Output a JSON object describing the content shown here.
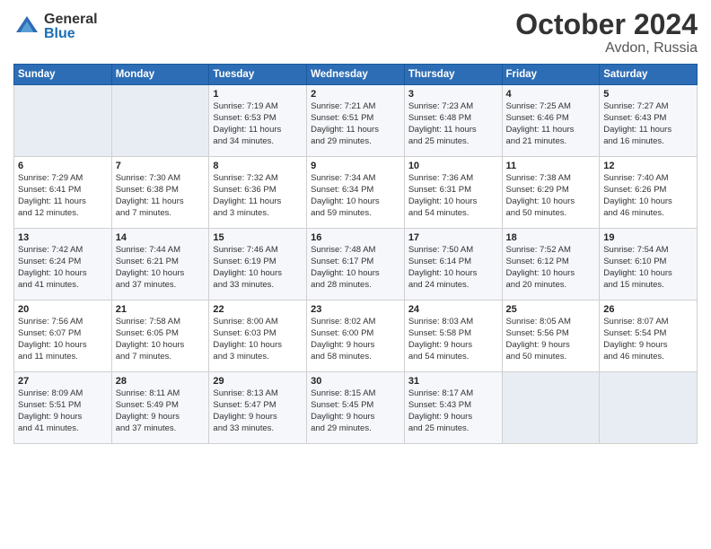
{
  "header": {
    "logo_general": "General",
    "logo_blue": "Blue",
    "month_title": "October 2024",
    "location": "Avdon, Russia"
  },
  "weekdays": [
    "Sunday",
    "Monday",
    "Tuesday",
    "Wednesday",
    "Thursday",
    "Friday",
    "Saturday"
  ],
  "weeks": [
    [
      {
        "day": "",
        "info": ""
      },
      {
        "day": "",
        "info": ""
      },
      {
        "day": "1",
        "info": "Sunrise: 7:19 AM\nSunset: 6:53 PM\nDaylight: 11 hours\nand 34 minutes."
      },
      {
        "day": "2",
        "info": "Sunrise: 7:21 AM\nSunset: 6:51 PM\nDaylight: 11 hours\nand 29 minutes."
      },
      {
        "day": "3",
        "info": "Sunrise: 7:23 AM\nSunset: 6:48 PM\nDaylight: 11 hours\nand 25 minutes."
      },
      {
        "day": "4",
        "info": "Sunrise: 7:25 AM\nSunset: 6:46 PM\nDaylight: 11 hours\nand 21 minutes."
      },
      {
        "day": "5",
        "info": "Sunrise: 7:27 AM\nSunset: 6:43 PM\nDaylight: 11 hours\nand 16 minutes."
      }
    ],
    [
      {
        "day": "6",
        "info": "Sunrise: 7:29 AM\nSunset: 6:41 PM\nDaylight: 11 hours\nand 12 minutes."
      },
      {
        "day": "7",
        "info": "Sunrise: 7:30 AM\nSunset: 6:38 PM\nDaylight: 11 hours\nand 7 minutes."
      },
      {
        "day": "8",
        "info": "Sunrise: 7:32 AM\nSunset: 6:36 PM\nDaylight: 11 hours\nand 3 minutes."
      },
      {
        "day": "9",
        "info": "Sunrise: 7:34 AM\nSunset: 6:34 PM\nDaylight: 10 hours\nand 59 minutes."
      },
      {
        "day": "10",
        "info": "Sunrise: 7:36 AM\nSunset: 6:31 PM\nDaylight: 10 hours\nand 54 minutes."
      },
      {
        "day": "11",
        "info": "Sunrise: 7:38 AM\nSunset: 6:29 PM\nDaylight: 10 hours\nand 50 minutes."
      },
      {
        "day": "12",
        "info": "Sunrise: 7:40 AM\nSunset: 6:26 PM\nDaylight: 10 hours\nand 46 minutes."
      }
    ],
    [
      {
        "day": "13",
        "info": "Sunrise: 7:42 AM\nSunset: 6:24 PM\nDaylight: 10 hours\nand 41 minutes."
      },
      {
        "day": "14",
        "info": "Sunrise: 7:44 AM\nSunset: 6:21 PM\nDaylight: 10 hours\nand 37 minutes."
      },
      {
        "day": "15",
        "info": "Sunrise: 7:46 AM\nSunset: 6:19 PM\nDaylight: 10 hours\nand 33 minutes."
      },
      {
        "day": "16",
        "info": "Sunrise: 7:48 AM\nSunset: 6:17 PM\nDaylight: 10 hours\nand 28 minutes."
      },
      {
        "day": "17",
        "info": "Sunrise: 7:50 AM\nSunset: 6:14 PM\nDaylight: 10 hours\nand 24 minutes."
      },
      {
        "day": "18",
        "info": "Sunrise: 7:52 AM\nSunset: 6:12 PM\nDaylight: 10 hours\nand 20 minutes."
      },
      {
        "day": "19",
        "info": "Sunrise: 7:54 AM\nSunset: 6:10 PM\nDaylight: 10 hours\nand 15 minutes."
      }
    ],
    [
      {
        "day": "20",
        "info": "Sunrise: 7:56 AM\nSunset: 6:07 PM\nDaylight: 10 hours\nand 11 minutes."
      },
      {
        "day": "21",
        "info": "Sunrise: 7:58 AM\nSunset: 6:05 PM\nDaylight: 10 hours\nand 7 minutes."
      },
      {
        "day": "22",
        "info": "Sunrise: 8:00 AM\nSunset: 6:03 PM\nDaylight: 10 hours\nand 3 minutes."
      },
      {
        "day": "23",
        "info": "Sunrise: 8:02 AM\nSunset: 6:00 PM\nDaylight: 9 hours\nand 58 minutes."
      },
      {
        "day": "24",
        "info": "Sunrise: 8:03 AM\nSunset: 5:58 PM\nDaylight: 9 hours\nand 54 minutes."
      },
      {
        "day": "25",
        "info": "Sunrise: 8:05 AM\nSunset: 5:56 PM\nDaylight: 9 hours\nand 50 minutes."
      },
      {
        "day": "26",
        "info": "Sunrise: 8:07 AM\nSunset: 5:54 PM\nDaylight: 9 hours\nand 46 minutes."
      }
    ],
    [
      {
        "day": "27",
        "info": "Sunrise: 8:09 AM\nSunset: 5:51 PM\nDaylight: 9 hours\nand 41 minutes."
      },
      {
        "day": "28",
        "info": "Sunrise: 8:11 AM\nSunset: 5:49 PM\nDaylight: 9 hours\nand 37 minutes."
      },
      {
        "day": "29",
        "info": "Sunrise: 8:13 AM\nSunset: 5:47 PM\nDaylight: 9 hours\nand 33 minutes."
      },
      {
        "day": "30",
        "info": "Sunrise: 8:15 AM\nSunset: 5:45 PM\nDaylight: 9 hours\nand 29 minutes."
      },
      {
        "day": "31",
        "info": "Sunrise: 8:17 AM\nSunset: 5:43 PM\nDaylight: 9 hours\nand 25 minutes."
      },
      {
        "day": "",
        "info": ""
      },
      {
        "day": "",
        "info": ""
      }
    ]
  ]
}
